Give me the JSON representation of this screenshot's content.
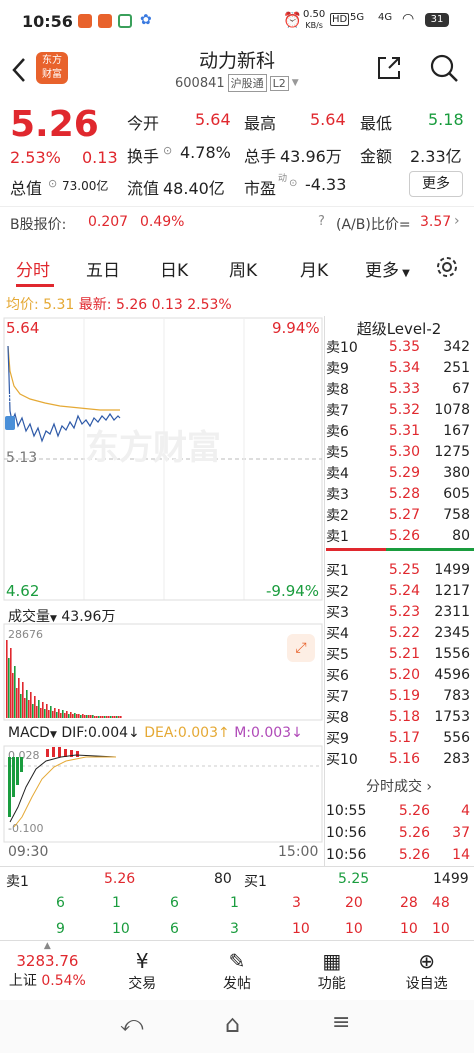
{
  "status_bar": {
    "time": "10:56",
    "net_speed": "0.50",
    "net_unit": "KB/s",
    "hd": "HD",
    "signal": "5G",
    "signal2": "4G",
    "battery": "31"
  },
  "header": {
    "logo_text": "东方财富",
    "name": "动力新科",
    "code": "600841",
    "exchange_tag": "沪股通",
    "level_tag": "L2"
  },
  "quote": {
    "price": "5.26",
    "change_pct": "2.53%",
    "change": "0.13",
    "open_label": "今开",
    "open": "5.64",
    "high_label": "最高",
    "high": "5.64",
    "low_label": "最低",
    "low": "5.18",
    "turnover_label": "换手",
    "turnover": "4.78%",
    "volume_label": "总手",
    "volume": "43.96万",
    "amount_label": "金额",
    "amount": "2.33亿",
    "mcap_label": "总值",
    "mcap": "73.00亿",
    "float_label": "流值",
    "float_cap": "48.40亿",
    "pe_label": "市盈",
    "pe_sup": "动",
    "pe": "-4.33",
    "more_label": "更多",
    "b_label": "B股报价:",
    "b_price": "0.207",
    "b_pct": "0.49%",
    "ratio_label": "(A/B)比价=",
    "ratio": "3.57"
  },
  "tabs": [
    "分时",
    "五日",
    "日K",
    "周K",
    "月K",
    "更多"
  ],
  "intraday": {
    "avg_label": "均价:",
    "avg": "5.31",
    "last_label": "最新:",
    "last": "5.26",
    "change": "0.13",
    "pct": "2.53%",
    "top_price": "5.64",
    "top_pct": "9.94%",
    "mid_price": "5.13",
    "bottom_price": "4.62",
    "bottom_pct": "-9.94%",
    "watermark": "东方财富",
    "vol_label": "成交量",
    "vol_value": "43.96万",
    "vol_max": "28676",
    "macd_label": "MACD",
    "dif_label": "DIF:",
    "dif": "0.004",
    "dea_label": "DEA:",
    "dea": "0.003",
    "m_label": "M:",
    "m": "0.003",
    "macd_top": "0.028",
    "macd_bottom": "-0.100",
    "time_start": "09:30",
    "time_end": "15:00",
    "badge": "S"
  },
  "orderbook": {
    "title": "超级Level-2",
    "asks": [
      {
        "label": "卖10",
        "price": "5.35",
        "vol": "342"
      },
      {
        "label": "卖9",
        "price": "5.34",
        "vol": "251"
      },
      {
        "label": "卖8",
        "price": "5.33",
        "vol": "67"
      },
      {
        "label": "卖7",
        "price": "5.32",
        "vol": "1078"
      },
      {
        "label": "卖6",
        "price": "5.31",
        "vol": "167"
      },
      {
        "label": "卖5",
        "price": "5.30",
        "vol": "1275"
      },
      {
        "label": "卖4",
        "price": "5.29",
        "vol": "380"
      },
      {
        "label": "卖3",
        "price": "5.28",
        "vol": "605"
      },
      {
        "label": "卖2",
        "price": "5.27",
        "vol": "758"
      },
      {
        "label": "卖1",
        "price": "5.26",
        "vol": "80"
      }
    ],
    "bids": [
      {
        "label": "买1",
        "price": "5.25",
        "vol": "1499"
      },
      {
        "label": "买2",
        "price": "5.24",
        "vol": "1217"
      },
      {
        "label": "买3",
        "price": "5.23",
        "vol": "2311"
      },
      {
        "label": "买4",
        "price": "5.22",
        "vol": "2345"
      },
      {
        "label": "买5",
        "price": "5.21",
        "vol": "1556"
      },
      {
        "label": "买6",
        "price": "5.20",
        "vol": "4596"
      },
      {
        "label": "买7",
        "price": "5.19",
        "vol": "783"
      },
      {
        "label": "买8",
        "price": "5.18",
        "vol": "1753"
      },
      {
        "label": "买9",
        "price": "5.17",
        "vol": "556"
      },
      {
        "label": "买10",
        "price": "5.16",
        "vol": "283"
      }
    ],
    "trades_title": "分时成交",
    "trades": [
      {
        "time": "10:55",
        "price": "5.26",
        "vol": "4"
      },
      {
        "time": "10:56",
        "price": "5.26",
        "vol": "37"
      },
      {
        "time": "10:56",
        "price": "5.26",
        "vol": "14"
      }
    ]
  },
  "queue": {
    "sell_label": "卖1",
    "sell_price": "5.26",
    "sell_vol": "80",
    "buy_label": "买1",
    "buy_price": "5.25",
    "buy_vol": "1499",
    "sell_row1": [
      "6",
      "1",
      "6",
      "1"
    ],
    "sell_row2": [
      "9",
      "10",
      "6",
      "3"
    ],
    "buy_row1": [
      "3",
      "20",
      "28",
      "48"
    ],
    "buy_row2": [
      "10",
      "10",
      "10",
      "10"
    ]
  },
  "bottom_nav": {
    "index_value": "3283.76",
    "index_name": "上证",
    "index_pct": "0.54%",
    "items": [
      "交易",
      "发帖",
      "功能",
      "设自选"
    ]
  }
}
